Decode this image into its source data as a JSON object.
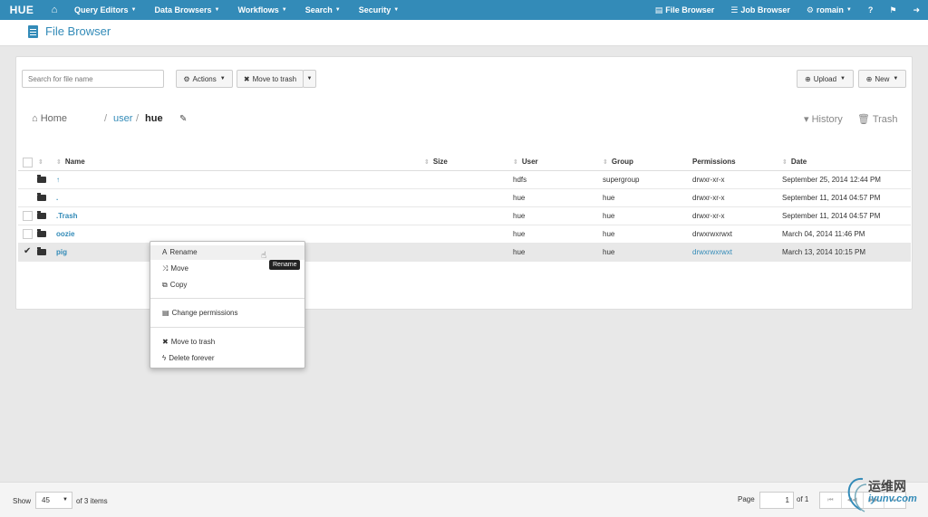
{
  "nav": {
    "logo": "HUE",
    "items": [
      "Query Editors",
      "Data Browsers",
      "Workflows",
      "Search",
      "Security"
    ],
    "right": [
      "File Browser",
      "Job Browser",
      "romain"
    ]
  },
  "page": {
    "title": "File Browser"
  },
  "toolbar": {
    "search_placeholder": "Search for file name",
    "actions": "Actions",
    "move_to_trash": "Move to trash",
    "upload": "Upload",
    "new": "New"
  },
  "breadcrumb": {
    "home": "Home",
    "user": "user",
    "current": "hue",
    "sep": "/"
  },
  "side_links": {
    "history": "History",
    "trash": "Trash"
  },
  "table": {
    "columns": [
      "Name",
      "Size",
      "User",
      "Group",
      "Permissions",
      "Date"
    ],
    "rows": [
      {
        "name": "↑",
        "size": "",
        "user": "hdfs",
        "group": "supergroup",
        "perm": "drwxr-xr-x",
        "date": "September 25, 2014 12:44 PM"
      },
      {
        "name": ".",
        "size": "",
        "user": "hue",
        "group": "hue",
        "perm": "drwxr-xr-x",
        "date": "September 11, 2014 04:57 PM"
      },
      {
        "name": ".Trash",
        "size": "",
        "user": "hue",
        "group": "hue",
        "perm": "drwxr-xr-x",
        "date": "September 11, 2014 04:57 PM"
      },
      {
        "name": "oozie",
        "size": "",
        "user": "hue",
        "group": "hue",
        "perm": "drwxrwxrwxt",
        "date": "March 04, 2014 11:46 PM"
      },
      {
        "name": "pig",
        "size": "",
        "user": "hue",
        "group": "hue",
        "perm": "drwxrwxrwxt",
        "date": "March 13, 2014 10:15 PM"
      }
    ]
  },
  "context_menu": {
    "rename": "Rename",
    "move": "Move",
    "copy": "Copy",
    "change_permissions": "Change permissions",
    "move_to_trash": "Move to trash",
    "delete_forever": "Delete forever"
  },
  "tooltip": "Rename",
  "footer": {
    "show": "Show",
    "page_size": "45",
    "items": "of 3 items",
    "page_label": "Page",
    "page_value": "1",
    "of_pages": "of 1"
  },
  "watermark": {
    "text": "运维网",
    "sub": "iyunv.com"
  },
  "colors": {
    "brand": "#338bb8"
  }
}
